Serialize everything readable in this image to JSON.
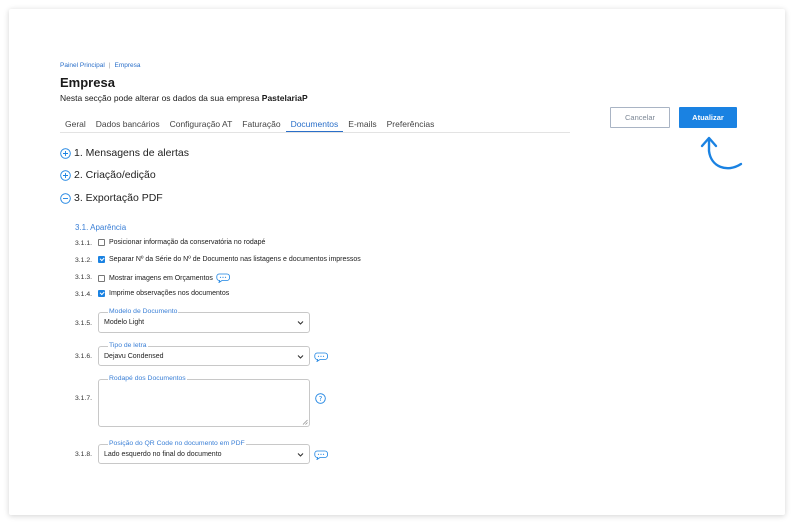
{
  "breadcrumb": {
    "home": "Painel Principal",
    "separator": "|",
    "current": "Empresa"
  },
  "page": {
    "title": "Empresa",
    "subtitle_prefix": "Nesta secção pode alterar os dados da sua empresa",
    "company_name": "PastelariaP"
  },
  "tabs": [
    {
      "label": "Geral",
      "active": false
    },
    {
      "label": "Dados bancários",
      "active": false
    },
    {
      "label": "Configuração AT",
      "active": false
    },
    {
      "label": "Faturação",
      "active": false
    },
    {
      "label": "Documentos",
      "active": true
    },
    {
      "label": "E-mails",
      "active": false
    },
    {
      "label": "Preferências",
      "active": false
    }
  ],
  "actions": {
    "cancel": "Cancelar",
    "update": "Atualizar"
  },
  "sections": [
    {
      "label": "1. Mensagens de alertas",
      "icon": "plus-circle-icon",
      "expanded": false
    },
    {
      "label": "2. Criação/edição",
      "icon": "plus-circle-icon",
      "expanded": false
    },
    {
      "label": "3. Exportação PDF",
      "icon": "minus-circle-icon",
      "expanded": true
    }
  ],
  "pdf": {
    "subheading": "3.1. Aparência",
    "options": [
      {
        "num": "3.1.1.",
        "label": "Posicionar informação da conservatória no rodapé",
        "checked": false,
        "help": false
      },
      {
        "num": "3.1.2.",
        "label": "Separar Nº da Série do Nº de Documento nas listagens e documentos impressos",
        "checked": true,
        "help": false
      },
      {
        "num": "3.1.3.",
        "label": "Mostrar imagens em Orçamentos",
        "checked": false,
        "help": true
      },
      {
        "num": "3.1.4.",
        "label": "Imprime observações nos documentos",
        "checked": true,
        "help": false
      }
    ],
    "fields": [
      {
        "num": "3.1.5.",
        "legend": "Modelo de Documento",
        "value": "Modelo Light"
      },
      {
        "num": "3.1.6.",
        "legend": "Tipo de letra",
        "value": "Dejavu Condensed"
      },
      {
        "num": "3.1.7.",
        "legend": "Rodapé dos Documentos",
        "value": ""
      },
      {
        "num": "3.1.8.",
        "legend": "Posição do QR Code no documento em PDF",
        "value": "Lado esquerdo no final do documento"
      }
    ]
  },
  "colors": {
    "accent": "#1a82e2",
    "link": "#2a6fc9",
    "legend": "#3a7fd6"
  }
}
